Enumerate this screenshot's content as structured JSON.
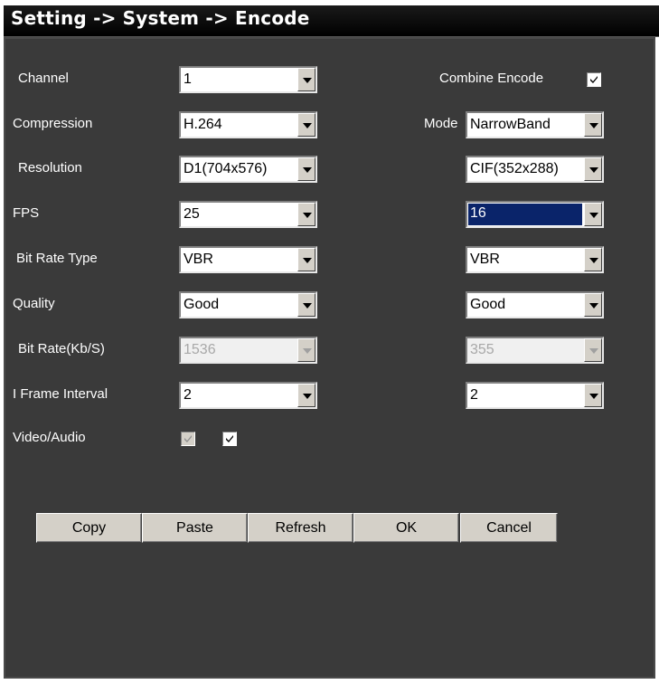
{
  "title": "Setting -> System -> Encode",
  "labels": {
    "channel": "Channel",
    "compression": "Compression",
    "resolution": "Resolution",
    "fps": "FPS",
    "bit_rate_type": "Bit Rate Type",
    "quality": "Quality",
    "bit_rate": "Bit Rate(Kb/S)",
    "i_frame_interval": "I Frame Interval",
    "video_audio": "Video/Audio",
    "combine_encode": "Combine Encode",
    "mode": "Mode"
  },
  "main_stream": {
    "channel": "1",
    "compression": "H.264",
    "resolution": "D1(704x576)",
    "fps": "25",
    "bit_rate_type": "VBR",
    "quality": "Good",
    "bit_rate": "1536",
    "i_frame_interval": "2",
    "video_checked": true,
    "video_enabled": false
  },
  "extra_stream": {
    "mode": "NarrowBand",
    "resolution": "CIF(352x288)",
    "fps": "16",
    "bit_rate_type": "VBR",
    "quality": "Good",
    "bit_rate": "355",
    "i_frame_interval": "2",
    "audio_checked": true
  },
  "combine_encode_checked": true,
  "buttons": {
    "copy": "Copy",
    "paste": "Paste",
    "refresh": "Refresh",
    "ok": "OK",
    "cancel": "Cancel"
  },
  "colors": {
    "panel": "#3a3a3a",
    "titlebar": "#000000",
    "highlight": "#0a246a",
    "button_face": "#d4d0c8"
  }
}
